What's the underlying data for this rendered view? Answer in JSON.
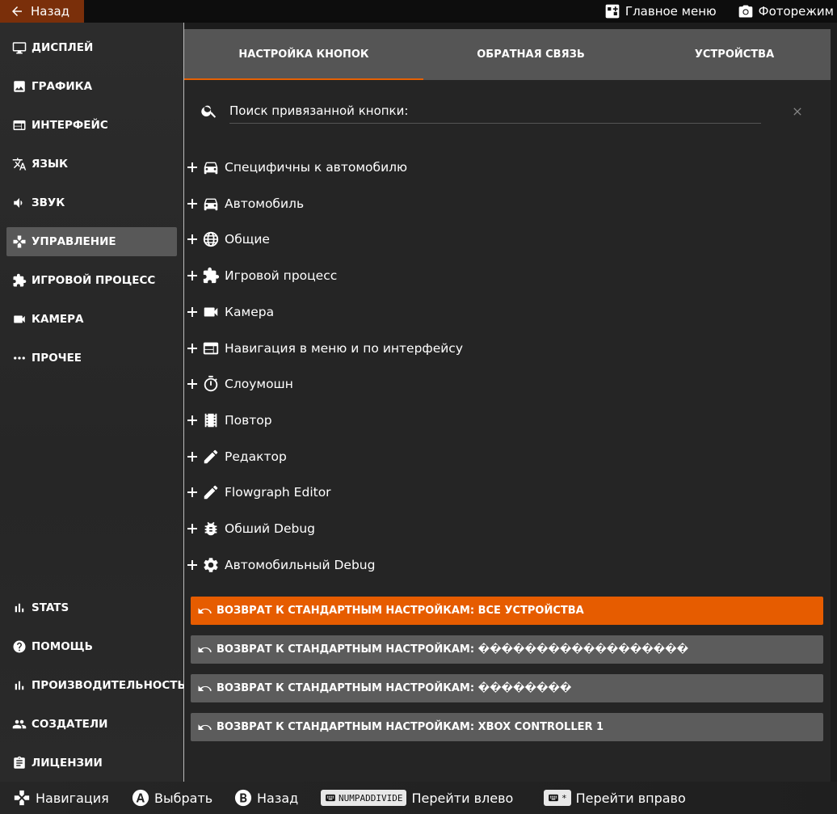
{
  "topbar": {
    "back_label": "Назад",
    "main_menu_label": "Главное меню",
    "photo_mode_label": "Фоторежим"
  },
  "sidebar": {
    "items": [
      {
        "label": "ДИСПЛЕЙ",
        "icon": "monitor-icon"
      },
      {
        "label": "ГРАФИКА",
        "icon": "image-icon"
      },
      {
        "label": "ИНТЕРФЕЙС",
        "icon": "window-icon"
      },
      {
        "label": "ЯЗЫК",
        "icon": "translate-icon"
      },
      {
        "label": "ЗВУК",
        "icon": "speaker-icon"
      },
      {
        "label": "УПРАВЛЕНИЕ",
        "icon": "gamepad-icon",
        "active": true
      },
      {
        "label": "ИГРОВОЙ ПРОЦЕСС",
        "icon": "puzzle-icon"
      },
      {
        "label": "КАМЕРА",
        "icon": "videocam-icon"
      },
      {
        "label": "ПРОЧЕЕ",
        "icon": "more-icon"
      }
    ],
    "bottom_items": [
      {
        "label": "STATS",
        "icon": "bar-chart-icon"
      },
      {
        "label": "ПОМОЩЬ",
        "icon": "help-icon"
      },
      {
        "label": "ПРОИЗВОДИТЕЛЬНОСТЬ",
        "icon": "bar-chart-icon"
      },
      {
        "label": "СОЗДАТЕЛИ",
        "icon": "people-icon"
      },
      {
        "label": "ЛИЦЕНЗИИ",
        "icon": "clipboard-icon"
      }
    ]
  },
  "tabs": [
    {
      "label": "НАСТРОЙКА КНОПОК",
      "active": true
    },
    {
      "label": "ОБРАТНАЯ СВЯЗЬ"
    },
    {
      "label": "УСТРОЙСТВА"
    }
  ],
  "search": {
    "placeholder": "Поиск привязанной кнопки:"
  },
  "categories": [
    {
      "label": "Специфичны к автомобилю",
      "icon": "car-icon"
    },
    {
      "label": "Автомобиль",
      "icon": "car-icon"
    },
    {
      "label": "Общие",
      "icon": "globe-icon"
    },
    {
      "label": "Игровой процесс",
      "icon": "puzzle-icon"
    },
    {
      "label": "Камера",
      "icon": "videocam-icon"
    },
    {
      "label": "Навигация в меню и по интерфейсу",
      "icon": "window-icon"
    },
    {
      "label": "Слоумошн",
      "icon": "timer-icon"
    },
    {
      "label": "Повтор",
      "icon": "film-icon"
    },
    {
      "label": "Редактор",
      "icon": "pencil-icon"
    },
    {
      "label": "Flowgraph Editor",
      "icon": "pencil-icon"
    },
    {
      "label": "Обший Debug",
      "icon": "bug-icon"
    },
    {
      "label": "Автомобильный Debug",
      "icon": "gear-icon"
    }
  ],
  "resets": [
    {
      "label": "ВОЗВРАТ К СТАНДАРТНЫМ НАСТРОЙКАМ: ВСЕ УСТРОЙСТВА",
      "active": true
    },
    {
      "label": "ВОЗВРАТ К СТАНДАРТНЫМ НАСТРОЙКАМ: ������������������"
    },
    {
      "label": "ВОЗВРАТ К СТАНДАРТНЫМ НАСТРОЙКАМ: ��������"
    },
    {
      "label": "ВОЗВРАТ К СТАНДАРТНЫМ НАСТРОЙКАМ: XBOX CONTROLLER 1"
    }
  ],
  "bottombar": {
    "navigate_label": "Навигация",
    "select_label": "Выбрать",
    "back_label": "Назад",
    "left_key": "NUMPADDIVIDE",
    "left_label": "Перейти влево",
    "right_key": "*",
    "right_label": "Перейти вправо"
  },
  "colors": {
    "accent": "#e65c00",
    "back_button": "#7a2f0a",
    "tab_bar": "#555555",
    "reset_button": "#5c5c5c"
  }
}
